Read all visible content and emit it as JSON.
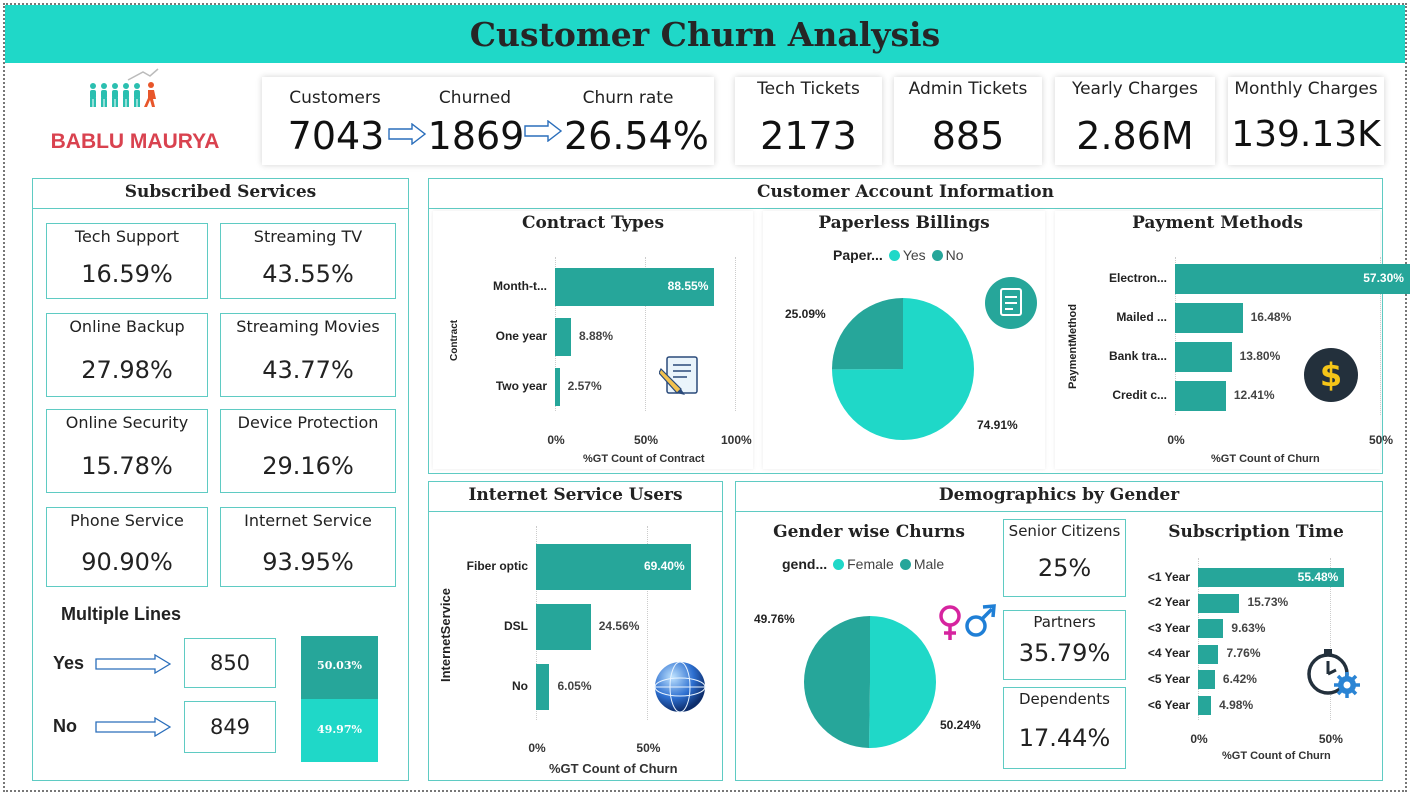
{
  "title": "Customer Churn Analysis",
  "brand": {
    "name": "BABLU MAURYA",
    "color": "#d9424f"
  },
  "colors": {
    "header": "#1fd8c8",
    "primary": "#26a69a",
    "light": "#1fd8c8",
    "border": "#5fcbc3"
  },
  "kpis": {
    "customers": {
      "label": "Customers",
      "value": "7043"
    },
    "churned": {
      "label": "Churned",
      "value": "1869"
    },
    "churn_rate": {
      "label": "Churn rate",
      "value": "26.54%"
    },
    "tech_tickets": {
      "label": "Tech Tickets",
      "value": "2173"
    },
    "admin_tickets": {
      "label": "Admin Tickets",
      "value": "885"
    },
    "yearly_charges": {
      "label": "Yearly Charges",
      "value": "2.86M"
    },
    "monthly_charges": {
      "label": "Monthly Charges",
      "value": "139.13K"
    }
  },
  "subscribed": {
    "title": "Subscribed Services",
    "items": [
      {
        "label": "Tech Support",
        "value": "16.59%"
      },
      {
        "label": "Streaming TV",
        "value": "43.55%"
      },
      {
        "label": "Online Backup",
        "value": "27.98%"
      },
      {
        "label": "Streaming Movies",
        "value": "43.77%"
      },
      {
        "label": "Online Security",
        "value": "15.78%"
      },
      {
        "label": "Device Protection",
        "value": "29.16%"
      },
      {
        "label": "Phone Service",
        "value": "90.90%"
      },
      {
        "label": "Internet Service",
        "value": "93.95%"
      }
    ],
    "multiple_lines": {
      "title": "Multiple Lines",
      "yes_label": "Yes",
      "yes_value": "850",
      "yes_pct": "50.03%",
      "no_label": "No",
      "no_value": "849",
      "no_pct": "49.97%"
    }
  },
  "account": {
    "title": "Customer Account Information",
    "contract_title": "Contract Types",
    "paperless_title": "Paperless Billings",
    "payment_title": "Payment Methods"
  },
  "internet_title": "Internet Service Users",
  "demographics": {
    "title": "Demographics by Gender",
    "gender_title": "Gender wise Churns",
    "subscription_title": "Subscription Time",
    "senior": {
      "label": "Senior Citizens",
      "value": "25%"
    },
    "partners": {
      "label": "Partners",
      "value": "35.79%"
    },
    "dependents": {
      "label": "Dependents",
      "value": "17.44%"
    }
  },
  "chart_data": [
    {
      "id": "contract",
      "type": "bar",
      "categories": [
        "Month-t...",
        "One year",
        "Two year"
      ],
      "values": [
        88.55,
        8.88,
        2.57
      ],
      "value_labels": [
        "88.55%",
        "8.88%",
        "2.57%"
      ],
      "xlabel": "%GT Count of Contract",
      "ylabel": "Contract",
      "xlim": [
        0,
        100
      ],
      "ticks": [
        "0%",
        "50%",
        "100%"
      ]
    },
    {
      "id": "paperless",
      "type": "pie",
      "legend_title": "Paper...",
      "labels": [
        "Yes",
        "No"
      ],
      "values": [
        74.91,
        25.09
      ],
      "value_labels": [
        "74.91%",
        "25.09%"
      ]
    },
    {
      "id": "payment",
      "type": "bar",
      "categories": [
        "Electron...",
        "Mailed ...",
        "Bank tra...",
        "Credit c..."
      ],
      "values": [
        57.3,
        16.48,
        13.8,
        12.41
      ],
      "value_labels": [
        "57.30%",
        "16.48%",
        "13.80%",
        "12.41%"
      ],
      "xlabel": "%GT Count of Churn",
      "ylabel": "PaymentMethod",
      "xlim": [
        0,
        60
      ],
      "ticks": [
        "0%",
        "50%"
      ]
    },
    {
      "id": "internet",
      "type": "bar",
      "categories": [
        "Fiber optic",
        "DSL",
        "No"
      ],
      "values": [
        69.4,
        24.56,
        6.05
      ],
      "value_labels": [
        "69.40%",
        "24.56%",
        "6.05%"
      ],
      "xlabel": "%GT Count of Churn",
      "ylabel": "InternetService",
      "xlim": [
        0,
        70
      ],
      "ticks": [
        "0%",
        "50%"
      ]
    },
    {
      "id": "gender",
      "type": "pie",
      "legend_title": "gend...",
      "labels": [
        "Female",
        "Male"
      ],
      "values": [
        50.24,
        49.76
      ],
      "value_labels": [
        "50.24%",
        "49.76%"
      ]
    },
    {
      "id": "subscription",
      "type": "bar",
      "categories": [
        "<1 Year",
        "<2 Year",
        "<3 Year",
        "<4 Year",
        "<5 Year",
        "<6 Year"
      ],
      "values": [
        55.48,
        15.73,
        9.63,
        7.76,
        6.42,
        4.98
      ],
      "value_labels": [
        "55.48%",
        "15.73%",
        "9.63%",
        "7.76%",
        "6.42%",
        "4.98%"
      ],
      "xlabel": "%GT Count of Churn",
      "xlim": [
        0,
        58
      ],
      "ticks": [
        "0%",
        "50%"
      ]
    }
  ]
}
